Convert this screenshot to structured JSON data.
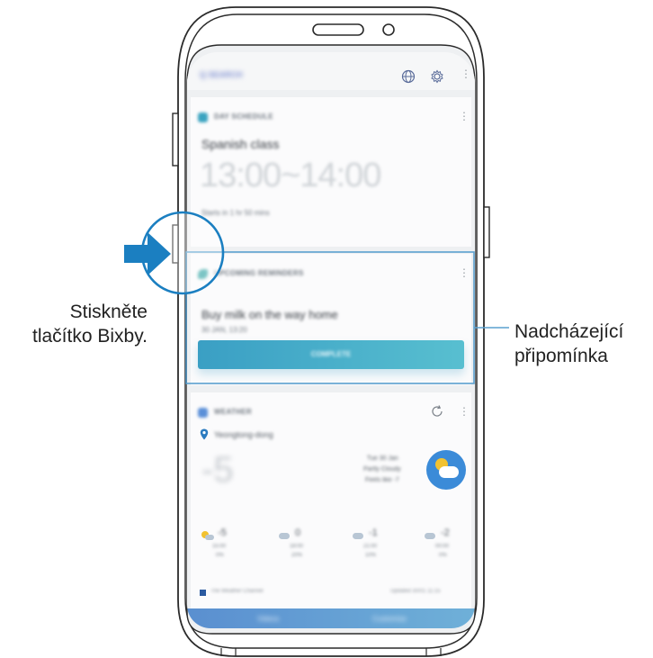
{
  "screen": {
    "search_text": "Q SEARCH",
    "schedule_card": {
      "header": "DAY SCHEDULE",
      "title": "Spanish class",
      "time": "13:00~14:00",
      "subtitle": "Starts in 1 hr 50 mins"
    },
    "reminder_card": {
      "header": "UPCOMING REMINDERS",
      "title": "Buy milk on the way home",
      "date": "30 JAN, 13:20",
      "button_label": "COMPLETE"
    },
    "weather_card": {
      "header": "WEATHER",
      "location": "Yeongtong-dong",
      "temperature": "-5",
      "summary_line1": "Tue 30 Jan",
      "summary_line2": "Partly Cloudy",
      "summary_line3": "Feels like -7",
      "forecast": [
        {
          "temp": "-5",
          "time": "15:00",
          "precip": "0%"
        },
        {
          "temp": "0",
          "time": "18:00",
          "precip": "20%"
        },
        {
          "temp": "-1",
          "time": "21:00",
          "precip": "10%"
        },
        {
          "temp": "-2",
          "time": "00:00",
          "precip": "0%"
        }
      ],
      "footer_left": "The Weather Channel",
      "footer_right": "Updated 30/01 11:15"
    },
    "bottom_bar": {
      "left": "Videos",
      "right": "Customise"
    }
  },
  "annotations": {
    "bixby_instruction_line1": "Stiskněte",
    "bixby_instruction_line2": "tlačítko Bixby.",
    "reminder_label_line1": "Nadcházející",
    "reminder_label_line2": "připomínka"
  },
  "colors": {
    "arrow": "#1b7fc1",
    "highlight": "#5aa0cf",
    "button": "#3fa9c8",
    "accent": "#2b7bc0"
  }
}
